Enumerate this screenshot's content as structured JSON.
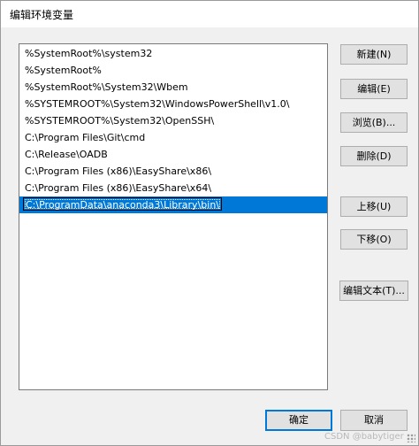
{
  "window": {
    "title": "编辑环境变量"
  },
  "paths": [
    "%SystemRoot%\\system32",
    "%SystemRoot%",
    "%SystemRoot%\\System32\\Wbem",
    "%SYSTEMROOT%\\System32\\WindowsPowerShell\\v1.0\\",
    "%SYSTEMROOT%\\System32\\OpenSSH\\",
    "C:\\Program Files\\Git\\cmd",
    "C:\\Release\\OADB",
    "C:\\Program Files (x86)\\EasyShare\\x86\\",
    "C:\\Program Files (x86)\\EasyShare\\x64\\"
  ],
  "editing_value": "C:\\ProgramData\\anaconda3\\Library\\bin\\",
  "buttons": {
    "new": "新建(N)",
    "edit": "编辑(E)",
    "browse": "浏览(B)...",
    "delete": "删除(D)",
    "move_up": "上移(U)",
    "move_down": "下移(O)",
    "edit_text": "编辑文本(T)...",
    "ok": "确定",
    "cancel": "取消"
  },
  "watermark": "CSDN @babytiger",
  "colors": {
    "selection": "#0078d7",
    "button_face": "#e1e1e1"
  }
}
